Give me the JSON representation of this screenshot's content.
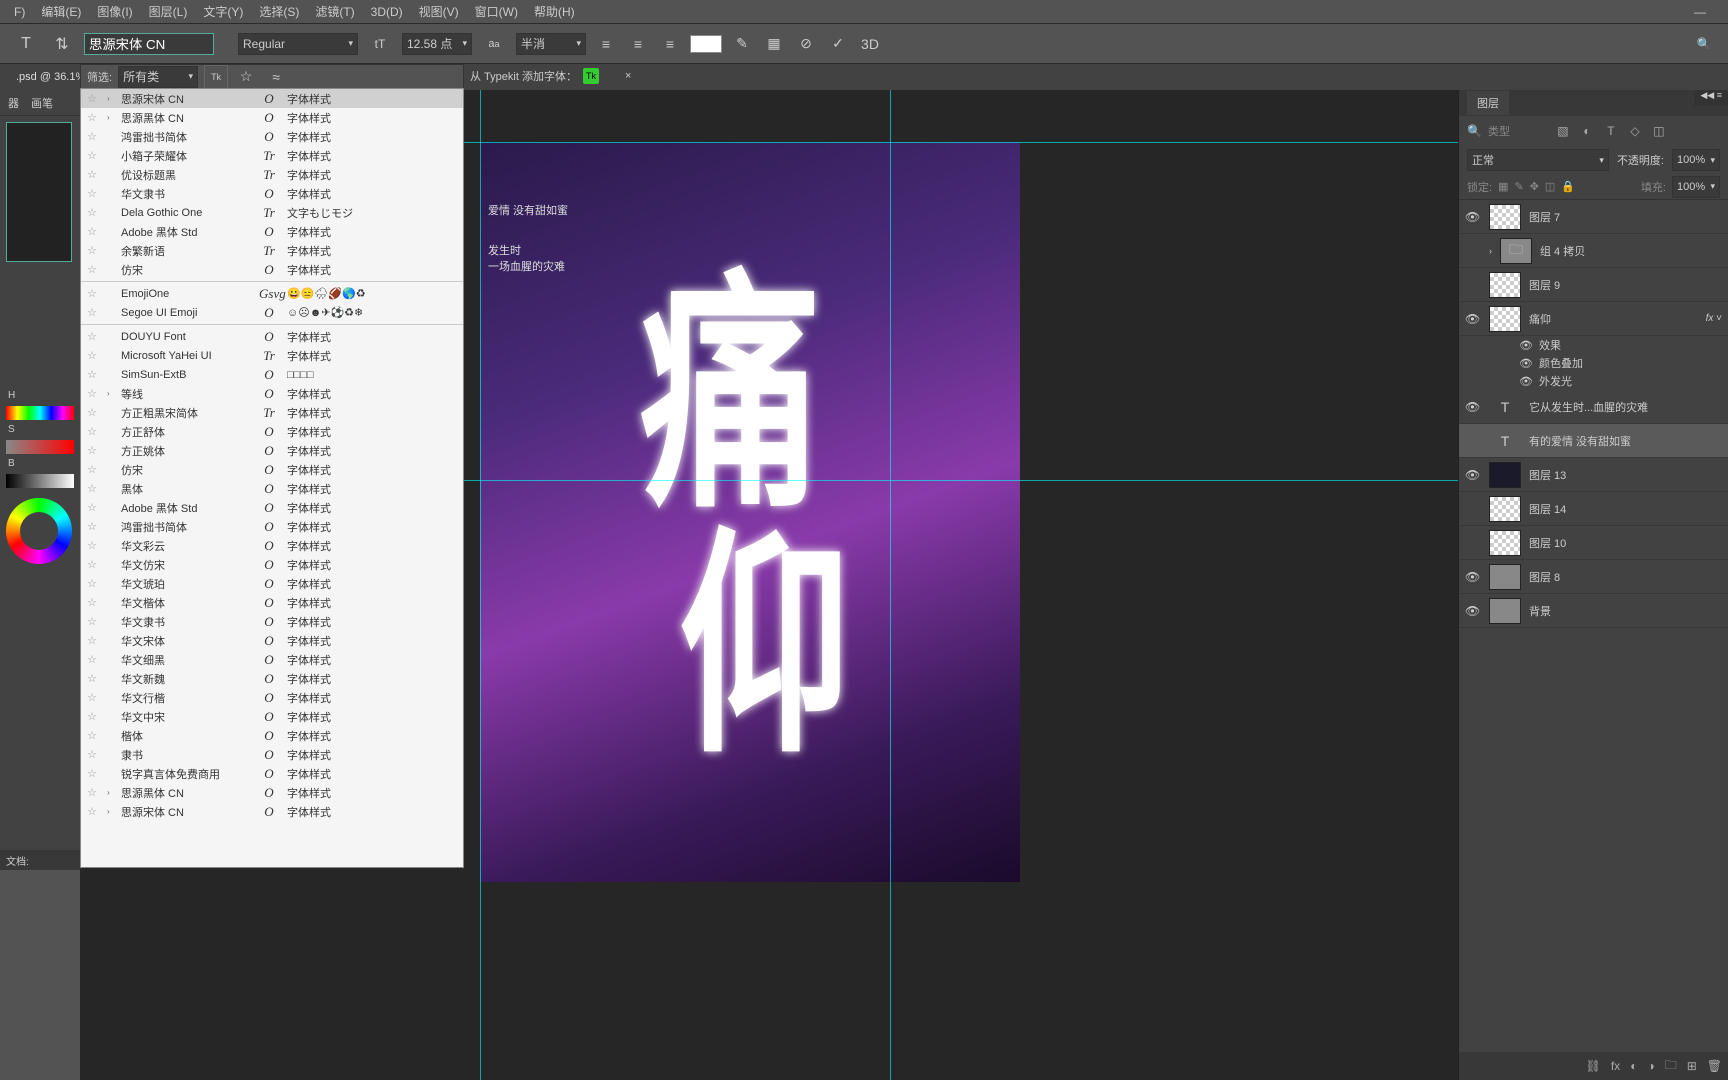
{
  "menu": [
    "F)",
    "编辑(E)",
    "图像(I)",
    "图层(L)",
    "文字(Y)",
    "选择(S)",
    "滤镜(T)",
    "3D(D)",
    "视图(V)",
    "窗口(W)",
    "帮助(H)"
  ],
  "tab": {
    "name": ".psd @ 36.1%",
    "x": "×"
  },
  "optbar": {
    "font_value": "思源宋体 CN",
    "weight": "Regular",
    "size": "12.58 点",
    "aa": "半消",
    "btn3d": "3D"
  },
  "filter": {
    "label": "筛选:",
    "all": "所有类",
    "tk": "Tk",
    "typekit": "从 Typekit 添加字体："
  },
  "fonts": {
    "g1": [
      {
        "n": "思源宋体 CN",
        "k": "O",
        "s": "字体样式",
        "arr": true,
        "hl": true
      },
      {
        "n": "思源黑体 CN",
        "k": "O",
        "s": "字体样式",
        "arr": true
      },
      {
        "n": "鸿雷拙书简体",
        "k": "O",
        "s": "字体样式"
      },
      {
        "n": "小箱子荣耀体",
        "k": "Tr",
        "s": "字体样式"
      },
      {
        "n": "优设标题黑",
        "k": "Tr",
        "s": "字体样式"
      },
      {
        "n": "华文隶书",
        "k": "O",
        "s": "字体样式"
      },
      {
        "n": "Dela Gothic One",
        "k": "Tr",
        "s": "文字もじモジ"
      },
      {
        "n": "Adobe 黑体 Std",
        "k": "O",
        "s": "字体样式"
      },
      {
        "n": "余繁新语",
        "k": "Tr",
        "s": "字体样式"
      },
      {
        "n": "仿宋",
        "k": "O",
        "s": "字体样式"
      }
    ],
    "g2": [
      {
        "n": "EmojiOne",
        "k": "Gsvg",
        "s": "😀😑🌧🏈🌎♻"
      },
      {
        "n": "Segoe UI Emoji",
        "k": "O",
        "s": "☺☹☻✈⚽♻❄"
      }
    ],
    "g3": [
      {
        "n": "DOUYU Font",
        "k": "O",
        "s": "字体样式"
      },
      {
        "n": "Microsoft YaHei UI",
        "k": "Tr",
        "s": "字体样式"
      },
      {
        "n": "SimSun-ExtB",
        "k": "O",
        "s": "□□□□"
      },
      {
        "n": "等线",
        "k": "O",
        "s": "字体样式",
        "arr": true
      },
      {
        "n": "方正粗黑宋简体",
        "k": "Tr",
        "s": "字体样式"
      },
      {
        "n": "方正舒体",
        "k": "O",
        "s": "字体样式"
      },
      {
        "n": "方正姚体",
        "k": "O",
        "s": "字体样式"
      },
      {
        "n": "仿宋",
        "k": "O",
        "s": "字体样式"
      },
      {
        "n": "黑体",
        "k": "O",
        "s": "字体样式"
      },
      {
        "n": "Adobe 黑体 Std",
        "k": "O",
        "s": "字体样式"
      },
      {
        "n": "鸿雷拙书简体",
        "k": "O",
        "s": "字体样式"
      },
      {
        "n": "华文彩云",
        "k": "O",
        "s": "字体样式"
      },
      {
        "n": "华文仿宋",
        "k": "O",
        "s": "字体样式"
      },
      {
        "n": "华文琥珀",
        "k": "O",
        "s": "字体样式"
      },
      {
        "n": "华文楷体",
        "k": "O",
        "s": "字体样式"
      },
      {
        "n": "华文隶书",
        "k": "O",
        "s": "字体样式"
      },
      {
        "n": "华文宋体",
        "k": "O",
        "s": "字体样式"
      },
      {
        "n": "华文细黑",
        "k": "O",
        "s": "字体样式"
      },
      {
        "n": "华文新魏",
        "k": "O",
        "s": "字体样式"
      },
      {
        "n": "华文行楷",
        "k": "O",
        "s": "字体样式"
      },
      {
        "n": "华文中宋",
        "k": "O",
        "s": "字体样式"
      },
      {
        "n": "楷体",
        "k": "O",
        "s": "字体样式"
      },
      {
        "n": "隶书",
        "k": "O",
        "s": "字体样式"
      },
      {
        "n": "锐字真言体免费商用",
        "k": "O",
        "s": "字体样式"
      },
      {
        "n": "思源黑体 CN",
        "k": "O",
        "s": "字体样式",
        "arr": true
      },
      {
        "n": "思源宋体 CN",
        "k": "O",
        "s": "字体样式",
        "arr": true
      }
    ]
  },
  "left": {
    "tab1": "器",
    "tab2": "画笔",
    "h": "H",
    "s": "S",
    "b": "B",
    "doc": "文档:"
  },
  "canvas_text": {
    "t1": "爱情 没有甜如蜜",
    "t2": "发生时",
    "t3": "一场血腥的灾难"
  },
  "layers": {
    "title": "图层",
    "type": "类型",
    "blend": "正常",
    "opacity_lbl": "不透明度:",
    "opacity": "100%",
    "lock": "锁定:",
    "fill_lbl": "填充:",
    "fill": "100%",
    "items": [
      {
        "eye": true,
        "name": "图层 7",
        "th": "checker"
      },
      {
        "eye": false,
        "name": "组 4 拷贝",
        "th": "folder",
        "arr": true
      },
      {
        "eye": false,
        "name": "图层 9",
        "th": "checker"
      },
      {
        "eye": true,
        "name": "痛仰",
        "th": "checker",
        "fx": true
      },
      {
        "fxlabel": "效果"
      },
      {
        "fxlabel": "颜色叠加"
      },
      {
        "fxlabel": "外发光"
      },
      {
        "eye": true,
        "name": "它从发生时...血腥的灾难",
        "th": "text"
      },
      {
        "eye": false,
        "name": "有的爱情 没有甜如蜜",
        "th": "text",
        "sel": true
      },
      {
        "eye": true,
        "name": "图层 13",
        "th": "dark"
      },
      {
        "eye": false,
        "name": "图层 14",
        "th": "checker"
      },
      {
        "eye": false,
        "name": "图层 10",
        "th": "checker"
      },
      {
        "eye": true,
        "name": "图层 8",
        "th": "img"
      },
      {
        "eye": true,
        "name": "背景",
        "th": "img"
      }
    ]
  }
}
